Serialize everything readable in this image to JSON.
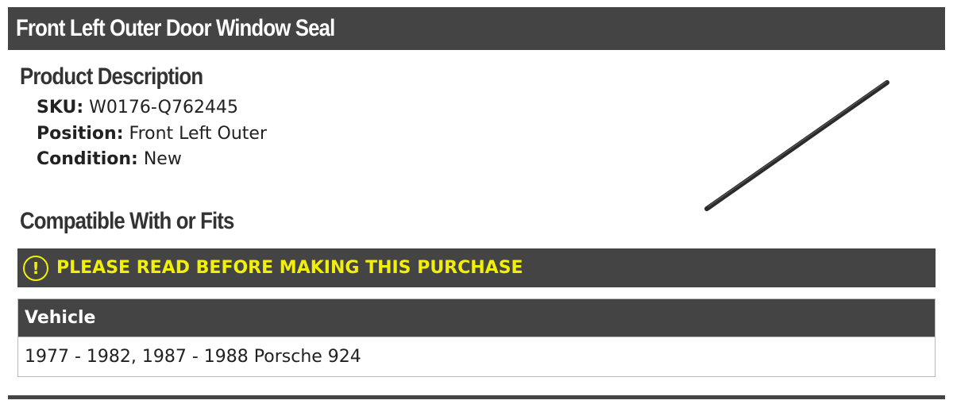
{
  "product": {
    "title": "Front Left Outer Door Window Seal"
  },
  "description": {
    "heading": "Product Description",
    "specs": [
      {
        "label": "SKU:",
        "value": "W0176-Q762445"
      },
      {
        "label": "Position:",
        "value": "Front Left Outer"
      },
      {
        "label": "Condition:",
        "value": "New"
      }
    ]
  },
  "compatibility": {
    "heading": "Compatible With or Fits",
    "warning": {
      "icon": "warning-circle-icon",
      "icon_glyph": "!",
      "text": "PLEASE READ BEFORE MAKING THIS PURCHASE",
      "color": "#f2ef0a"
    },
    "table": {
      "header": "Vehicle",
      "rows": [
        "1977 - 1982, 1987 - 1988 Porsche 924"
      ]
    }
  },
  "colors": {
    "bar_background": "#444444",
    "warning_text": "#f2ef0a"
  }
}
